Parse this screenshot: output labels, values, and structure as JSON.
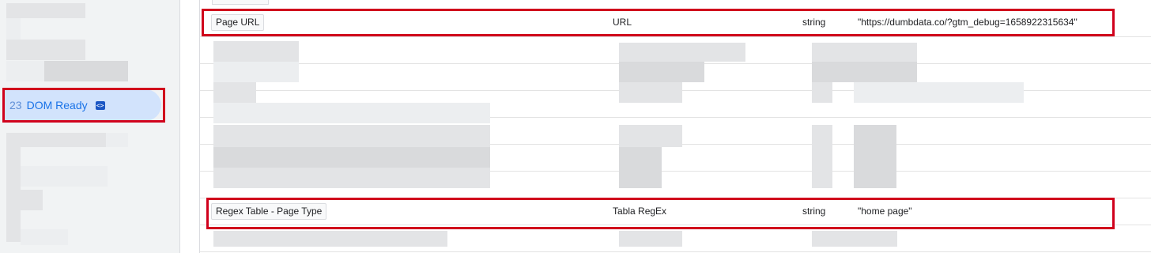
{
  "sidebar": {
    "selected_event": {
      "number": "23",
      "label": "DOM Ready",
      "badge_icon": "code-icon"
    },
    "highlight_color": "#d0001c"
  },
  "variables": [
    {
      "name": "Page URL",
      "type": "URL",
      "return_type": "string",
      "value": "\"https://dumbdata.co/?gtm_debug=1658922315634\""
    },
    {
      "name": "Regex Table - Page Type",
      "type": "Tabla RegEx",
      "return_type": "string",
      "value": "\"home page\""
    }
  ],
  "colors": {
    "accent": "#1a73e8",
    "selected_bg": "#d2e3fc",
    "highlight": "#d0001c"
  }
}
